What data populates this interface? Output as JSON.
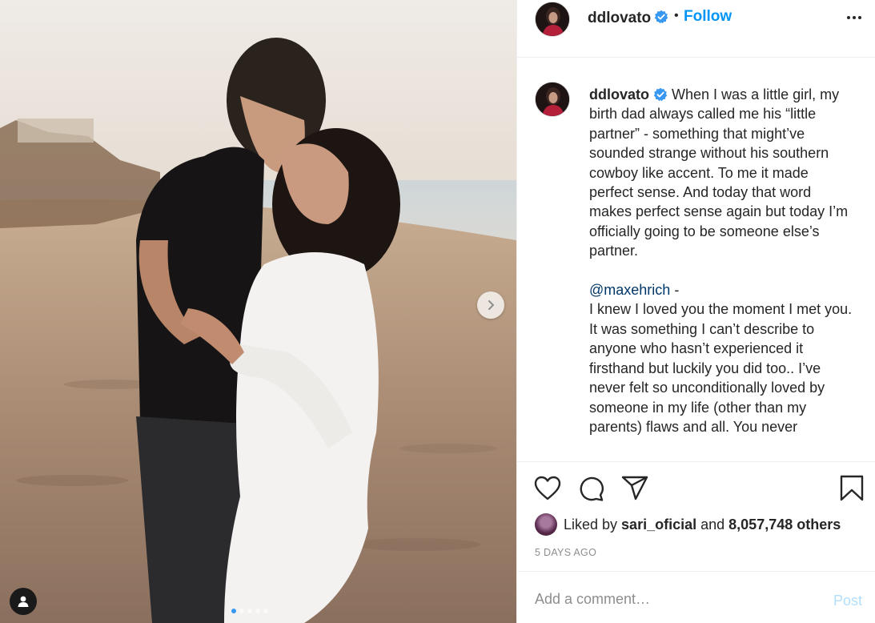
{
  "post": {
    "username": "ddlovato",
    "follow_label": "Follow",
    "separator": "•",
    "caption_intro": "When I was a little girl, my birth dad always called me his “little partner” - something that might’ve sounded strange without his southern cowboy like accent. To me it made perfect sense. And today that word makes perfect sense again but today I’m officially going to be someone else’s partner.",
    "mention": "@maxehrich",
    "mention_suffix": " -",
    "caption_body": "I knew I loved you the moment I met you.\nIt was something I can’t describe to anyone who hasn’t experienced it firsthand but luckily you did too.. I’ve never felt so unconditionally loved by someone in my life (other than my parents) flaws and all. You never",
    "liked_by_prefix": "Liked by ",
    "liked_by_user": "sari_oficial",
    "liked_by_and": " and ",
    "like_count": "8,057,748 others",
    "timestamp": "5 days ago",
    "comment_placeholder": "Add a comment…",
    "post_label": "Post"
  },
  "carousel": {
    "slide_count": 5,
    "active_index": 0
  },
  "colors": {
    "accent": "#0095f6",
    "verified": "#3897f0",
    "mention": "#00376b",
    "post_disabled": "#b2dffc",
    "muted": "#8e8e8e"
  },
  "icons": [
    "chevron-right-icon",
    "user-tag-icon",
    "verified-badge-icon",
    "more-options-icon",
    "heart-icon",
    "comment-icon",
    "share-icon",
    "bookmark-icon"
  ]
}
